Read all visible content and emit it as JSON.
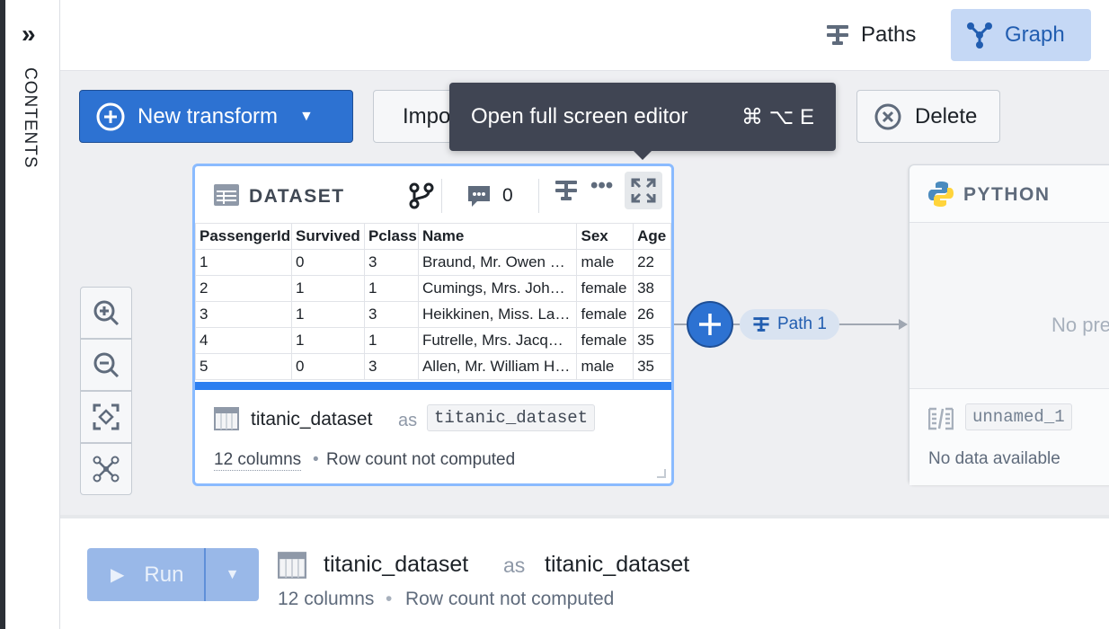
{
  "sidebar": {
    "label": "CONTENTS",
    "expand_icon": "double-chevron-right-icon"
  },
  "header": {
    "paths_label": "Paths",
    "graph_label": "Graph"
  },
  "toolbar": {
    "new_transform": "New transform",
    "import": "Import",
    "delete": "Delete"
  },
  "tooltip": {
    "text": "Open full screen editor",
    "shortcut": "⌘ ⌥ E"
  },
  "dataset_card": {
    "type_label": "DATASET",
    "comment_count": "0",
    "columns": [
      "PassengerId",
      "Survived",
      "Pclass",
      "Name",
      "Sex",
      "Age"
    ],
    "rows": [
      [
        "1",
        "0",
        "3",
        "Braund, Mr. Owen …",
        "male",
        "22"
      ],
      [
        "2",
        "1",
        "1",
        "Cumings, Mrs. Joh…",
        "female",
        "38"
      ],
      [
        "3",
        "1",
        "3",
        "Heikkinen, Miss. La…",
        "female",
        "26"
      ],
      [
        "4",
        "1",
        "1",
        "Futrelle, Mrs. Jacq…",
        "female",
        "35"
      ],
      [
        "5",
        "0",
        "3",
        "Allen, Mr. William H…",
        "male",
        "35"
      ]
    ],
    "name": "titanic_dataset",
    "as": "as",
    "alias": "titanic_dataset",
    "column_count": "12 columns",
    "row_count": "Row count not computed"
  },
  "edge": {
    "path_label": "Path 1"
  },
  "python_card": {
    "type_label": "PYTHON",
    "preview": "No preview",
    "output_name": "unnamed_1",
    "status": "No data available"
  },
  "bottom": {
    "run_label": "Run",
    "name": "titanic_dataset",
    "as": "as",
    "alias": "titanic_dataset",
    "column_count": "12 columns",
    "row_count": "Row count not computed"
  },
  "colors": {
    "primary": "#2d72d2",
    "tooltip_bg": "#404553",
    "canvas_bg": "#eeeff2",
    "selected_border": "#8abbff"
  }
}
